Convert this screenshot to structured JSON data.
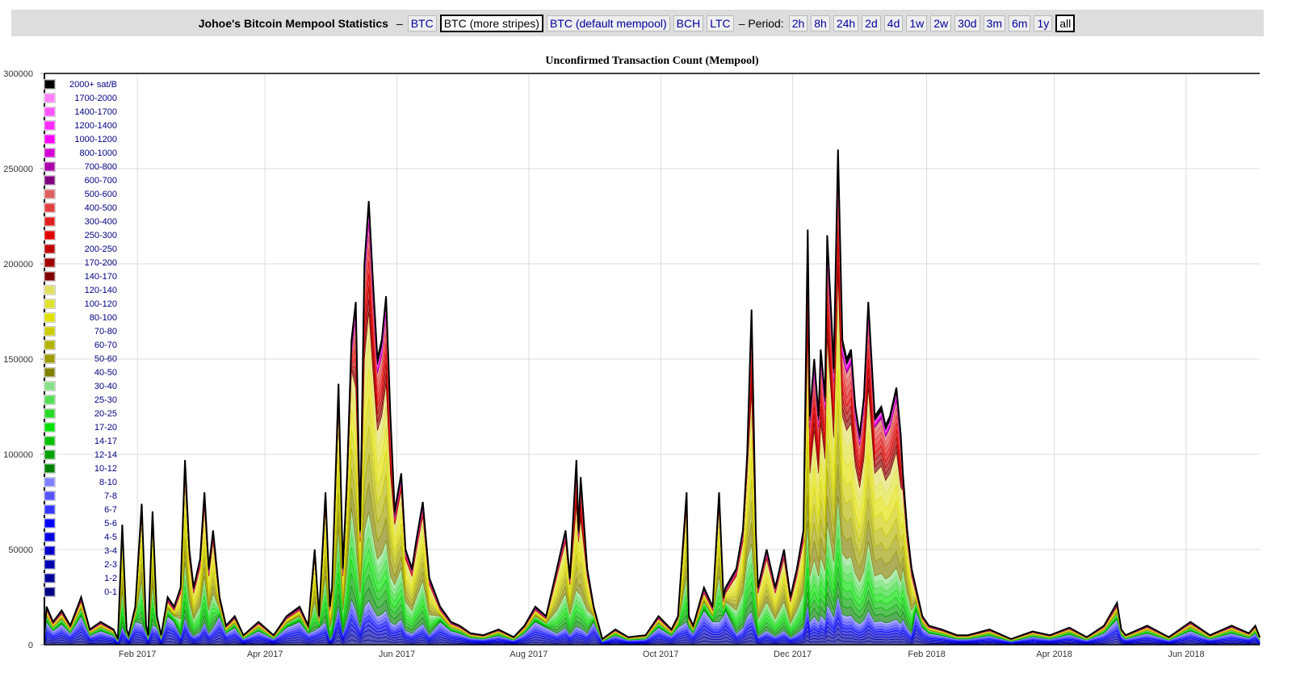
{
  "header": {
    "title": "Johoe's Bitcoin Mempool Statistics",
    "dash": "–",
    "coins": [
      {
        "label": "BTC",
        "selected": false
      },
      {
        "label": "BTC (more stripes)",
        "selected": true
      },
      {
        "label": "BTC (default mempool)",
        "selected": false
      },
      {
        "label": "BCH",
        "selected": false
      },
      {
        "label": "LTC",
        "selected": false
      }
    ],
    "period_label": "– Period:",
    "periods": [
      {
        "label": "2h",
        "selected": false
      },
      {
        "label": "8h",
        "selected": false
      },
      {
        "label": "24h",
        "selected": false
      },
      {
        "label": "2d",
        "selected": false
      },
      {
        "label": "4d",
        "selected": false
      },
      {
        "label": "1w",
        "selected": false
      },
      {
        "label": "2w",
        "selected": false
      },
      {
        "label": "30d",
        "selected": false
      },
      {
        "label": "3m",
        "selected": false
      },
      {
        "label": "6m",
        "selected": false
      },
      {
        "label": "1y",
        "selected": false
      },
      {
        "label": "all",
        "selected": true
      }
    ]
  },
  "chart_data": {
    "type": "area",
    "stacked": true,
    "title": "Unconfirmed Transaction Count (Mempool)",
    "xlabel": "",
    "ylabel": "",
    "x_unit": "days since 2017-01-01",
    "xlim": [
      -12,
      550
    ],
    "ylim": [
      0,
      300000
    ],
    "yticks": [
      0,
      50000,
      100000,
      150000,
      200000,
      250000,
      300000
    ],
    "xticks": [
      {
        "day": 31,
        "label": "Feb 2017"
      },
      {
        "day": 90,
        "label": "Apr 2017"
      },
      {
        "day": 151,
        "label": "Jun 2017"
      },
      {
        "day": 212,
        "label": "Aug 2017"
      },
      {
        "day": 273,
        "label": "Oct 2017"
      },
      {
        "day": 334,
        "label": "Dec 2017"
      },
      {
        "day": 396,
        "label": "Feb 2018"
      },
      {
        "day": 455,
        "label": "Apr 2018"
      },
      {
        "day": 516,
        "label": "Jun 2018"
      }
    ],
    "grid": true,
    "legend_position": "top-left",
    "bands": [
      {
        "name": "0-1",
        "color": "#000080",
        "group": "blue"
      },
      {
        "name": "1-2",
        "color": "#000098",
        "group": "blue"
      },
      {
        "name": "2-3",
        "color": "#0000b0",
        "group": "blue"
      },
      {
        "name": "3-4",
        "color": "#0000c8",
        "group": "blue"
      },
      {
        "name": "4-5",
        "color": "#0000e0",
        "group": "blue"
      },
      {
        "name": "5-6",
        "color": "#0000ff",
        "group": "blue"
      },
      {
        "name": "6-7",
        "color": "#3333ff",
        "group": "blue"
      },
      {
        "name": "7-8",
        "color": "#5555ff",
        "group": "blue"
      },
      {
        "name": "8-10",
        "color": "#8080ff",
        "group": "blue"
      },
      {
        "name": "10-12",
        "color": "#008000",
        "group": "green"
      },
      {
        "name": "12-14",
        "color": "#00a000",
        "group": "green"
      },
      {
        "name": "14-17",
        "color": "#00c000",
        "group": "green"
      },
      {
        "name": "17-20",
        "color": "#00e000",
        "group": "green"
      },
      {
        "name": "20-25",
        "color": "#2ad82a",
        "group": "green"
      },
      {
        "name": "25-30",
        "color": "#55dd55",
        "group": "green"
      },
      {
        "name": "30-40",
        "color": "#88e088",
        "group": "green"
      },
      {
        "name": "40-50",
        "color": "#808000",
        "group": "yellow"
      },
      {
        "name": "50-60",
        "color": "#9c9c00",
        "group": "yellow"
      },
      {
        "name": "60-70",
        "color": "#b4b400",
        "group": "yellow"
      },
      {
        "name": "70-80",
        "color": "#cccc00",
        "group": "yellow"
      },
      {
        "name": "80-100",
        "color": "#e0e000",
        "group": "yellow"
      },
      {
        "name": "100-120",
        "color": "#e0e030",
        "group": "yellow"
      },
      {
        "name": "120-140",
        "color": "#e0e060",
        "group": "yellow"
      },
      {
        "name": "140-170",
        "color": "#800000",
        "group": "red"
      },
      {
        "name": "170-200",
        "color": "#a00000",
        "group": "red"
      },
      {
        "name": "200-250",
        "color": "#c00000",
        "group": "red"
      },
      {
        "name": "250-300",
        "color": "#e00000",
        "group": "red"
      },
      {
        "name": "300-400",
        "color": "#e02020",
        "group": "red"
      },
      {
        "name": "400-500",
        "color": "#e04040",
        "group": "red"
      },
      {
        "name": "500-600",
        "color": "#e06060",
        "group": "red"
      },
      {
        "name": "600-700",
        "color": "#800080",
        "group": "purple"
      },
      {
        "name": "700-800",
        "color": "#aa00aa",
        "group": "purple"
      },
      {
        "name": "800-1000",
        "color": "#d400d4",
        "group": "purple"
      },
      {
        "name": "1000-1200",
        "color": "#ff00ff",
        "group": "purple"
      },
      {
        "name": "1200-1400",
        "color": "#ff2bff",
        "group": "purple"
      },
      {
        "name": "1400-1700",
        "color": "#ff55ff",
        "group": "purple"
      },
      {
        "name": "1700-2000",
        "color": "#ff80ff",
        "group": "purple"
      },
      {
        "name": "2000+ sat/B",
        "color": "#000000",
        "group": "black"
      }
    ],
    "regime_group_shares": {
      "low": {
        "blue": 0.6,
        "green": 0.15,
        "yellow": 0.15,
        "red": 0.04,
        "purple": 0.02,
        "black": 0.04
      },
      "mid": {
        "blue": 0.15,
        "green": 0.3,
        "yellow": 0.45,
        "red": 0.05,
        "purple": 0.02,
        "black": 0.03
      },
      "peak": {
        "blue": 0.1,
        "green": 0.2,
        "yellow": 0.45,
        "red": 0.2,
        "purple": 0.03,
        "black": 0.02
      }
    },
    "total_series": [
      [
        -12,
        5000,
        "low"
      ],
      [
        -11,
        20000,
        "low"
      ],
      [
        -8,
        12000,
        "low"
      ],
      [
        -4,
        18000,
        "low"
      ],
      [
        0,
        10000,
        "low"
      ],
      [
        5,
        25000,
        "low"
      ],
      [
        9,
        8000,
        "low"
      ],
      [
        14,
        12000,
        "low"
      ],
      [
        20,
        8000,
        "low"
      ],
      [
        22,
        3000,
        "low"
      ],
      [
        24,
        63000,
        "mid"
      ],
      [
        26,
        8000,
        "low"
      ],
      [
        27,
        5000,
        "low"
      ],
      [
        30,
        20000,
        "low"
      ],
      [
        33,
        74000,
        "mid"
      ],
      [
        35,
        10000,
        "low"
      ],
      [
        36,
        5000,
        "low"
      ],
      [
        38,
        70000,
        "mid"
      ],
      [
        40,
        15000,
        "low"
      ],
      [
        42,
        5000,
        "low"
      ],
      [
        45,
        25000,
        "low"
      ],
      [
        48,
        20000,
        "low"
      ],
      [
        51,
        30000,
        "mid"
      ],
      [
        53,
        97000,
        "mid"
      ],
      [
        55,
        50000,
        "mid"
      ],
      [
        57,
        30000,
        "mid"
      ],
      [
        60,
        45000,
        "mid"
      ],
      [
        62,
        80000,
        "mid"
      ],
      [
        64,
        40000,
        "mid"
      ],
      [
        66,
        60000,
        "mid"
      ],
      [
        69,
        25000,
        "low"
      ],
      [
        72,
        10000,
        "low"
      ],
      [
        76,
        15000,
        "low"
      ],
      [
        80,
        5000,
        "low"
      ],
      [
        87,
        12000,
        "low"
      ],
      [
        94,
        5000,
        "low"
      ],
      [
        100,
        15000,
        "low"
      ],
      [
        106,
        20000,
        "low"
      ],
      [
        110,
        10000,
        "low"
      ],
      [
        113,
        50000,
        "mid"
      ],
      [
        115,
        15000,
        "low"
      ],
      [
        118,
        80000,
        "mid"
      ],
      [
        120,
        20000,
        "mid"
      ],
      [
        121,
        30000,
        "mid"
      ],
      [
        124,
        137000,
        "mid"
      ],
      [
        126,
        40000,
        "mid"
      ],
      [
        128,
        90000,
        "mid"
      ],
      [
        130,
        160000,
        "mid"
      ],
      [
        132,
        180000,
        "peak"
      ],
      [
        134,
        60000,
        "mid"
      ],
      [
        136,
        200000,
        "peak"
      ],
      [
        138,
        233000,
        "peak"
      ],
      [
        140,
        190000,
        "peak"
      ],
      [
        142,
        150000,
        "peak"
      ],
      [
        144,
        160000,
        "peak"
      ],
      [
        146,
        183000,
        "peak"
      ],
      [
        148,
        120000,
        "peak"
      ],
      [
        150,
        70000,
        "mid"
      ],
      [
        153,
        90000,
        "mid"
      ],
      [
        155,
        50000,
        "mid"
      ],
      [
        158,
        40000,
        "mid"
      ],
      [
        160,
        55000,
        "mid"
      ],
      [
        163,
        75000,
        "mid"
      ],
      [
        166,
        35000,
        "mid"
      ],
      [
        171,
        20000,
        "low"
      ],
      [
        176,
        12000,
        "low"
      ],
      [
        180,
        10000,
        "low"
      ],
      [
        185,
        6000,
        "low"
      ],
      [
        191,
        5000,
        "low"
      ],
      [
        198,
        8000,
        "low"
      ],
      [
        205,
        4000,
        "low"
      ],
      [
        210,
        10000,
        "low"
      ],
      [
        215,
        20000,
        "low"
      ],
      [
        220,
        15000,
        "low"
      ],
      [
        225,
        40000,
        "mid"
      ],
      [
        229,
        60000,
        "mid"
      ],
      [
        231,
        35000,
        "mid"
      ],
      [
        234,
        97000,
        "peak"
      ],
      [
        235,
        60000,
        "mid"
      ],
      [
        236,
        88000,
        "peak"
      ],
      [
        239,
        40000,
        "mid"
      ],
      [
        242,
        20000,
        "low"
      ],
      [
        246,
        3000,
        "low"
      ],
      [
        252,
        8000,
        "low"
      ],
      [
        258,
        4000,
        "low"
      ],
      [
        266,
        5000,
        "low"
      ],
      [
        272,
        15000,
        "low"
      ],
      [
        278,
        8000,
        "low"
      ],
      [
        281,
        15000,
        "low"
      ],
      [
        285,
        80000,
        "mid"
      ],
      [
        286,
        15000,
        "low"
      ],
      [
        288,
        10000,
        "low"
      ],
      [
        293,
        30000,
        "low"
      ],
      [
        297,
        20000,
        "low"
      ],
      [
        300,
        80000,
        "mid"
      ],
      [
        302,
        25000,
        "low"
      ],
      [
        303,
        30000,
        "low"
      ],
      [
        308,
        40000,
        "mid"
      ],
      [
        311,
        60000,
        "mid"
      ],
      [
        313,
        100000,
        "mid"
      ],
      [
        315,
        176000,
        "peak"
      ],
      [
        317,
        60000,
        "mid"
      ],
      [
        318,
        30000,
        "mid"
      ],
      [
        322,
        50000,
        "mid"
      ],
      [
        326,
        30000,
        "mid"
      ],
      [
        330,
        50000,
        "mid"
      ],
      [
        333,
        25000,
        "mid"
      ],
      [
        336,
        40000,
        "mid"
      ],
      [
        339,
        60000,
        "mid"
      ],
      [
        341,
        218000,
        "peak"
      ],
      [
        342,
        120000,
        "peak"
      ],
      [
        344,
        150000,
        "peak"
      ],
      [
        346,
        120000,
        "peak"
      ],
      [
        347,
        155000,
        "peak"
      ],
      [
        349,
        130000,
        "peak"
      ],
      [
        350,
        215000,
        "peak"
      ],
      [
        352,
        170000,
        "peak"
      ],
      [
        353,
        145000,
        "peak"
      ],
      [
        355,
        260000,
        "peak"
      ],
      [
        357,
        160000,
        "peak"
      ],
      [
        359,
        150000,
        "peak"
      ],
      [
        361,
        155000,
        "peak"
      ],
      [
        363,
        125000,
        "peak"
      ],
      [
        365,
        110000,
        "peak"
      ],
      [
        367,
        130000,
        "peak"
      ],
      [
        369,
        180000,
        "peak"
      ],
      [
        371,
        140000,
        "peak"
      ],
      [
        372,
        120000,
        "peak"
      ],
      [
        375,
        125000,
        "peak"
      ],
      [
        377,
        115000,
        "peak"
      ],
      [
        379,
        120000,
        "peak"
      ],
      [
        382,
        135000,
        "peak"
      ],
      [
        384,
        110000,
        "peak"
      ],
      [
        385,
        90000,
        "mid"
      ],
      [
        387,
        60000,
        "mid"
      ],
      [
        389,
        40000,
        "mid"
      ],
      [
        391,
        30000,
        "low"
      ],
      [
        394,
        15000,
        "low"
      ],
      [
        397,
        10000,
        "low"
      ],
      [
        403,
        8000,
        "low"
      ],
      [
        410,
        5000,
        "low"
      ],
      [
        415,
        5000,
        "low"
      ],
      [
        425,
        8000,
        "low"
      ],
      [
        435,
        3000,
        "low"
      ],
      [
        445,
        7000,
        "low"
      ],
      [
        453,
        5000,
        "low"
      ],
      [
        462,
        9000,
        "low"
      ],
      [
        470,
        4000,
        "low"
      ],
      [
        478,
        10000,
        "low"
      ],
      [
        484,
        22000,
        "low"
      ],
      [
        486,
        8000,
        "low"
      ],
      [
        488,
        5000,
        "low"
      ],
      [
        498,
        10000,
        "low"
      ],
      [
        508,
        4000,
        "low"
      ],
      [
        518,
        12000,
        "low"
      ],
      [
        527,
        5000,
        "low"
      ],
      [
        537,
        10000,
        "low"
      ],
      [
        545,
        6000,
        "low"
      ],
      [
        548,
        10000,
        "low"
      ],
      [
        550,
        4000,
        "low"
      ]
    ]
  }
}
